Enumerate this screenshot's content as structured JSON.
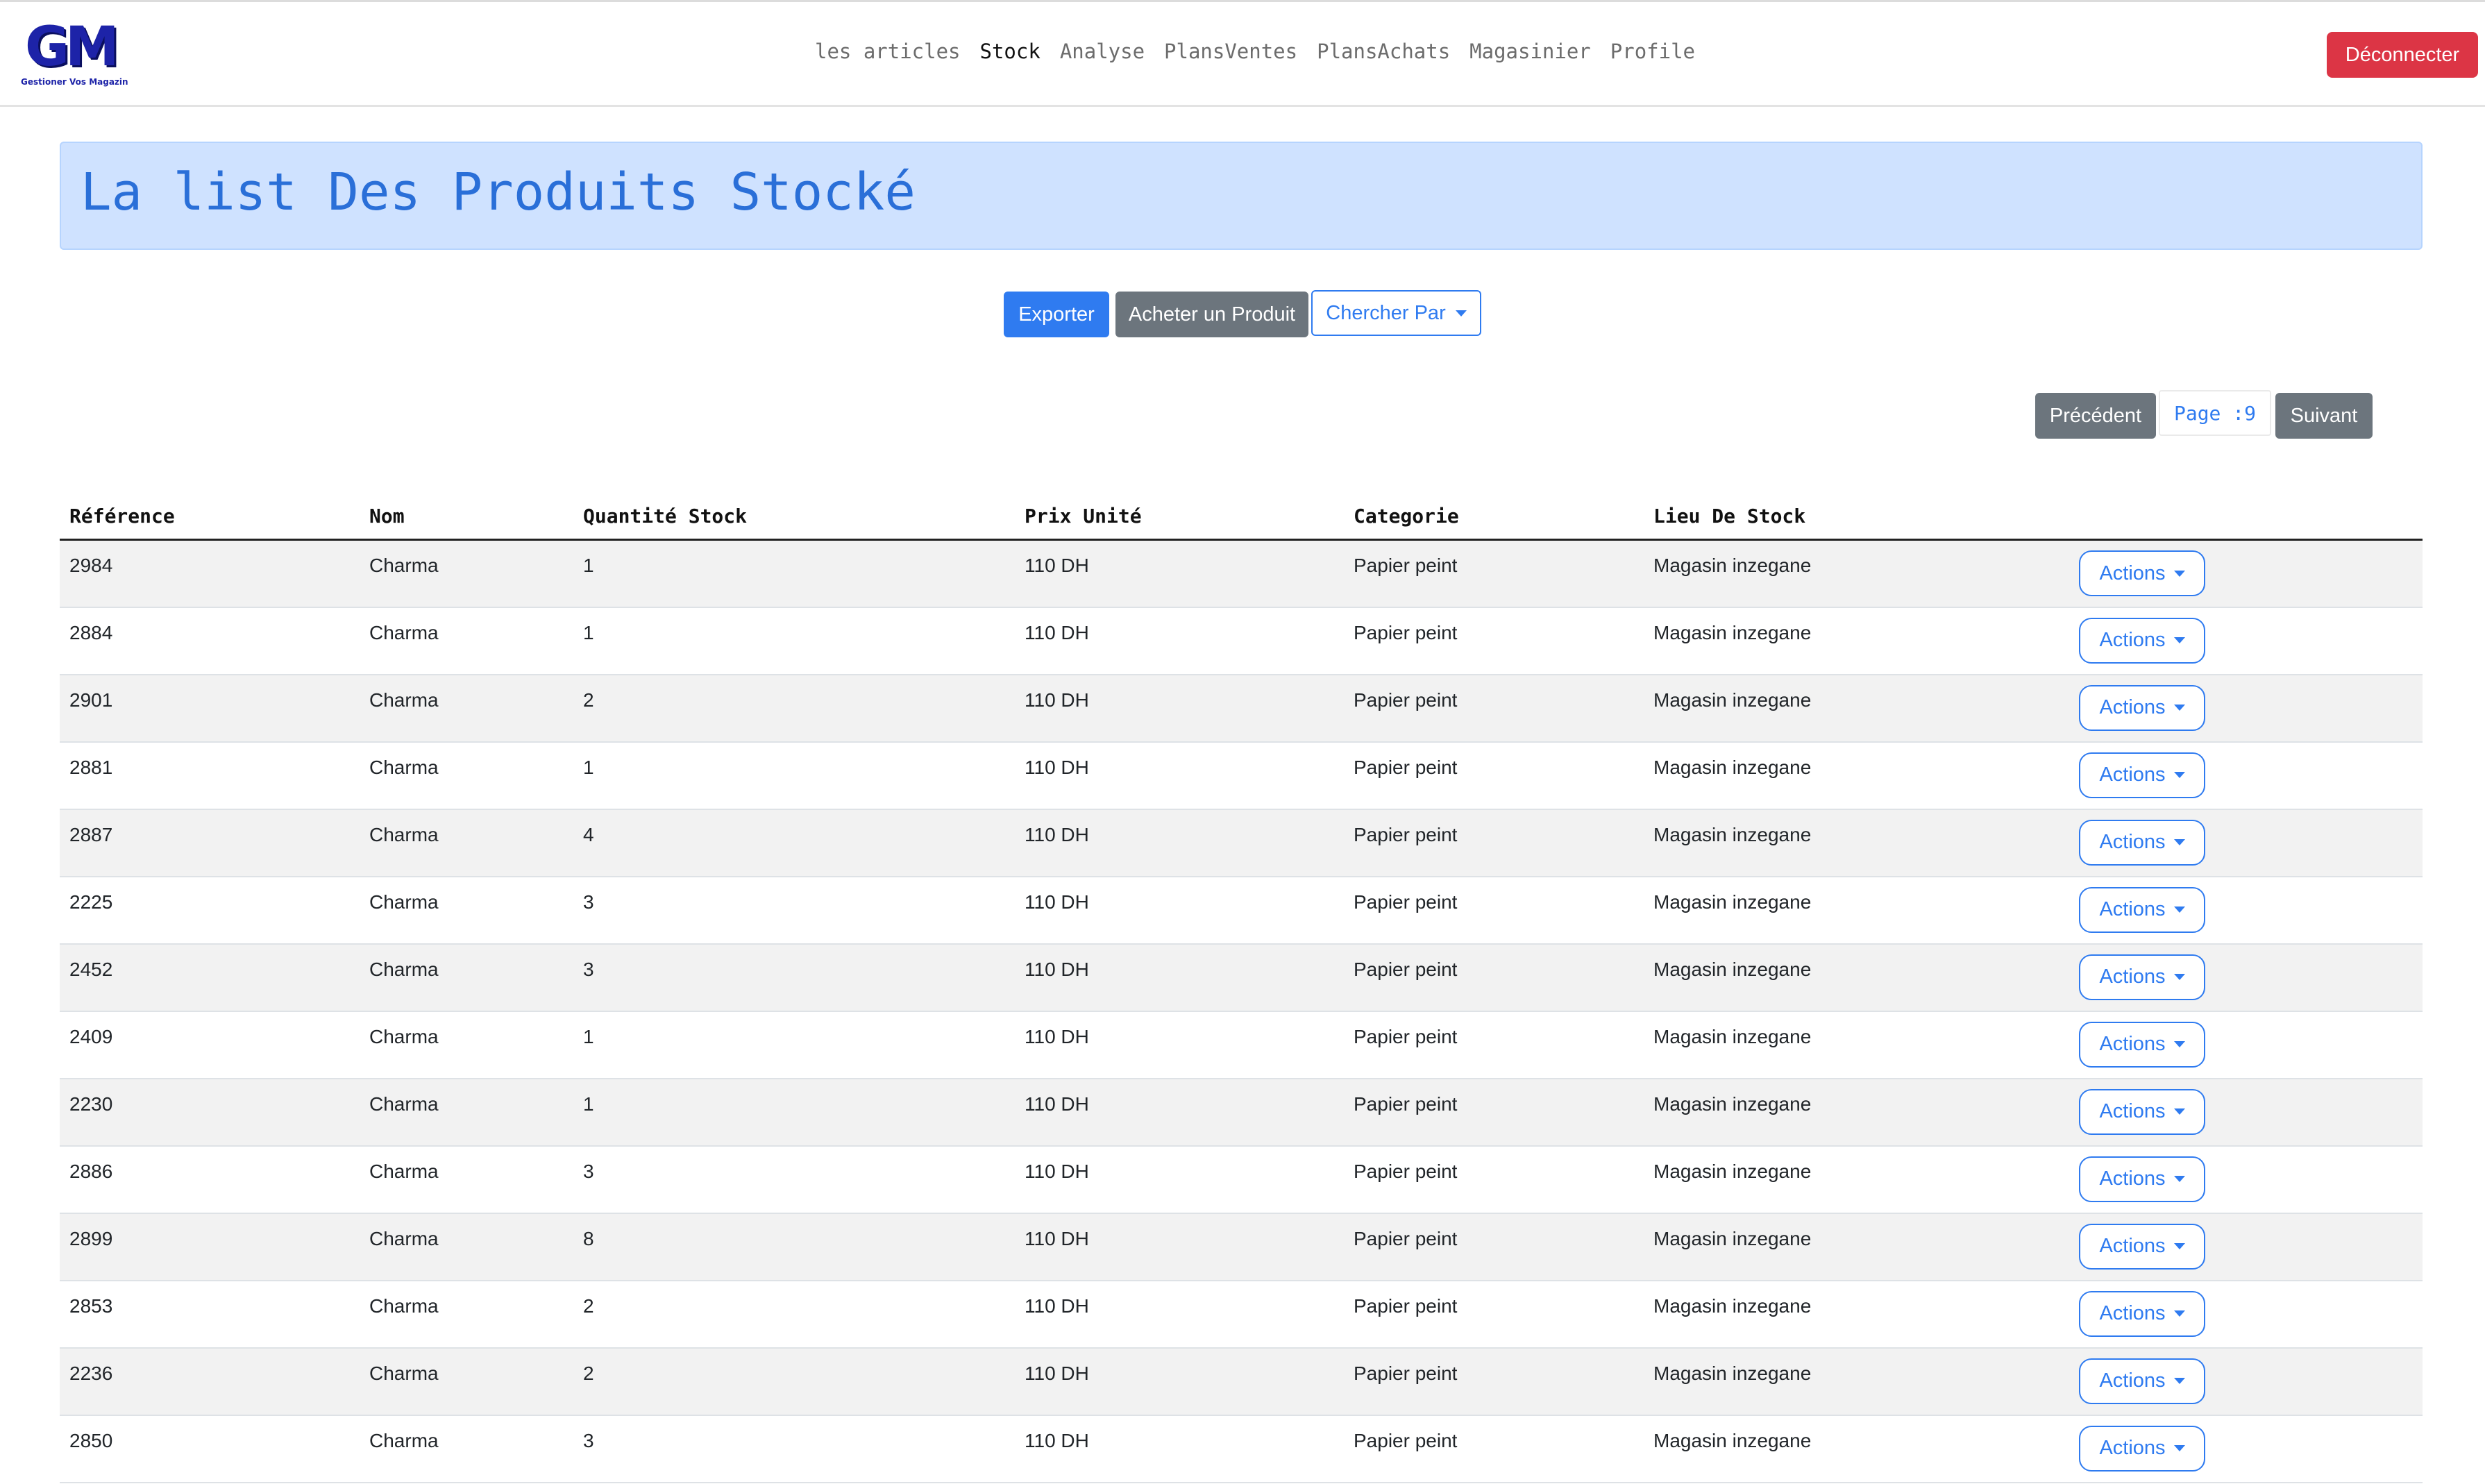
{
  "logo": {
    "letters": "GM",
    "tagline": "Gestioner Vos Magazin"
  },
  "nav": {
    "links": [
      {
        "label": "les articles",
        "active": false
      },
      {
        "label": "Stock",
        "active": true
      },
      {
        "label": "Analyse",
        "active": false
      },
      {
        "label": "PlansVentes",
        "active": false
      },
      {
        "label": "PlansAchats",
        "active": false
      },
      {
        "label": "Magasinier",
        "active": false
      },
      {
        "label": "Profile",
        "active": false
      }
    ],
    "logout_label": "Déconnecter"
  },
  "page": {
    "title": "La list Des Produits Stocké"
  },
  "toolbar": {
    "export_label": "Exporter",
    "buy_label": "Acheter un Produit",
    "search_label": "Chercher Par"
  },
  "pagination": {
    "prev_label": "Précédent",
    "page_text": "Page :9",
    "next_label": "Suivant"
  },
  "table": {
    "headers": [
      "Référence",
      "Nom",
      "Quantité Stock",
      "Prix Unité",
      "Categorie",
      "Lieu De Stock",
      ""
    ],
    "action_label": "Actions",
    "rows": [
      {
        "ref": "2984",
        "nom": "Charma",
        "qty": "1",
        "prix": "110 DH",
        "cat": "Papier peint",
        "lieu": "Magasin inzegane"
      },
      {
        "ref": "2884",
        "nom": "Charma",
        "qty": "1",
        "prix": "110 DH",
        "cat": "Papier peint",
        "lieu": "Magasin inzegane"
      },
      {
        "ref": "2901",
        "nom": "Charma",
        "qty": "2",
        "prix": "110 DH",
        "cat": "Papier peint",
        "lieu": "Magasin inzegane"
      },
      {
        "ref": "2881",
        "nom": "Charma",
        "qty": "1",
        "prix": "110 DH",
        "cat": "Papier peint",
        "lieu": "Magasin inzegane"
      },
      {
        "ref": "2887",
        "nom": "Charma",
        "qty": "4",
        "prix": "110 DH",
        "cat": "Papier peint",
        "lieu": "Magasin inzegane"
      },
      {
        "ref": "2225",
        "nom": "Charma",
        "qty": "3",
        "prix": "110 DH",
        "cat": "Papier peint",
        "lieu": "Magasin inzegane"
      },
      {
        "ref": "2452",
        "nom": "Charma",
        "qty": "3",
        "prix": "110 DH",
        "cat": "Papier peint",
        "lieu": "Magasin inzegane"
      },
      {
        "ref": "2409",
        "nom": "Charma",
        "qty": "1",
        "prix": "110 DH",
        "cat": "Papier peint",
        "lieu": "Magasin inzegane"
      },
      {
        "ref": "2230",
        "nom": "Charma",
        "qty": "1",
        "prix": "110 DH",
        "cat": "Papier peint",
        "lieu": "Magasin inzegane"
      },
      {
        "ref": "2886",
        "nom": "Charma",
        "qty": "3",
        "prix": "110 DH",
        "cat": "Papier peint",
        "lieu": "Magasin inzegane"
      },
      {
        "ref": "2899",
        "nom": "Charma",
        "qty": "8",
        "prix": "110 DH",
        "cat": "Papier peint",
        "lieu": "Magasin inzegane"
      },
      {
        "ref": "2853",
        "nom": "Charma",
        "qty": "2",
        "prix": "110 DH",
        "cat": "Papier peint",
        "lieu": "Magasin inzegane"
      },
      {
        "ref": "2236",
        "nom": "Charma",
        "qty": "2",
        "prix": "110 DH",
        "cat": "Papier peint",
        "lieu": "Magasin inzegane"
      },
      {
        "ref": "2850",
        "nom": "Charma",
        "qty": "3",
        "prix": "110 DH",
        "cat": "Papier peint",
        "lieu": "Magasin inzegane"
      }
    ]
  },
  "colors": {
    "primary": "#2f7bf0",
    "danger": "#dc3545",
    "secondary": "#6c757d",
    "banner_bg": "#cfe2ff",
    "banner_text": "#2a6fd8",
    "logo": "#1d23a8",
    "row_stripe": "#f2f2f2"
  },
  "icons": {
    "dropdown": "caret-down-icon"
  }
}
